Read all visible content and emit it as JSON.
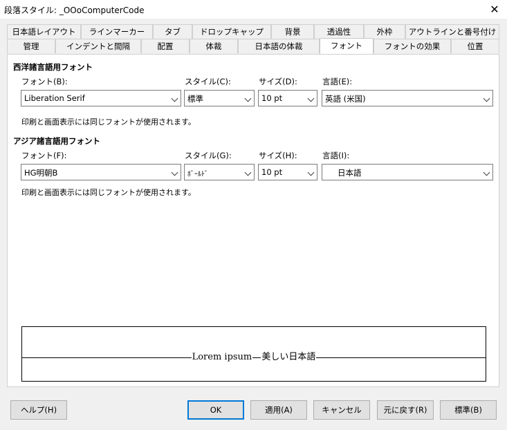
{
  "window": {
    "title": "段落スタイル: _OOoComputerCode",
    "close_glyph": "✕"
  },
  "tabs_row1": [
    "日本語レイアウト",
    "ラインマーカー",
    "タブ",
    "ドロップキャップ",
    "背景",
    "透過性",
    "外枠",
    "アウトラインと番号付け"
  ],
  "tabs_row2": [
    "管理",
    "インデントと間隔",
    "配置",
    "体裁",
    "日本語の体裁",
    "フォント",
    "フォントの効果",
    "位置"
  ],
  "active_tab": "フォント",
  "western": {
    "heading": "西洋諸言語用フォント",
    "font_label": "フォント(B):",
    "font_value": "Liberation Serif",
    "style_label": "スタイル(C):",
    "style_value": "標準",
    "size_label": "サイズ(D):",
    "size_value": "10 pt",
    "lang_label": "言語(E):",
    "lang_value": "英語 (米国)",
    "note": "印刷と画面表示には同じフォントが使用されます。"
  },
  "asian": {
    "heading": "アジア諸言語用フォント",
    "font_label": "フォント(F):",
    "font_value": "HG明朝B",
    "style_label": "スタイル(G):",
    "style_value": "ﾎﾞｰﾙﾄﾞ",
    "size_label": "サイズ(H):",
    "size_value": "10 pt",
    "lang_label": "言語(I):",
    "lang_value": "日本語",
    "note": "印刷と画面表示には同じフォントが使用されます。"
  },
  "preview": {
    "latin": "Lorem ipsum",
    "asian": "美しい日本語"
  },
  "buttons": {
    "help": "ヘルプ(H)",
    "ok": "OK",
    "apply": "適用(A)",
    "cancel": "キャンセル",
    "reset": "元に戻す(R)",
    "standard": "標準(B)"
  },
  "colors": {
    "focus_border": "#0078d7",
    "panel_bg": "#ffffff",
    "dialog_bg": "#f0f0f0"
  }
}
